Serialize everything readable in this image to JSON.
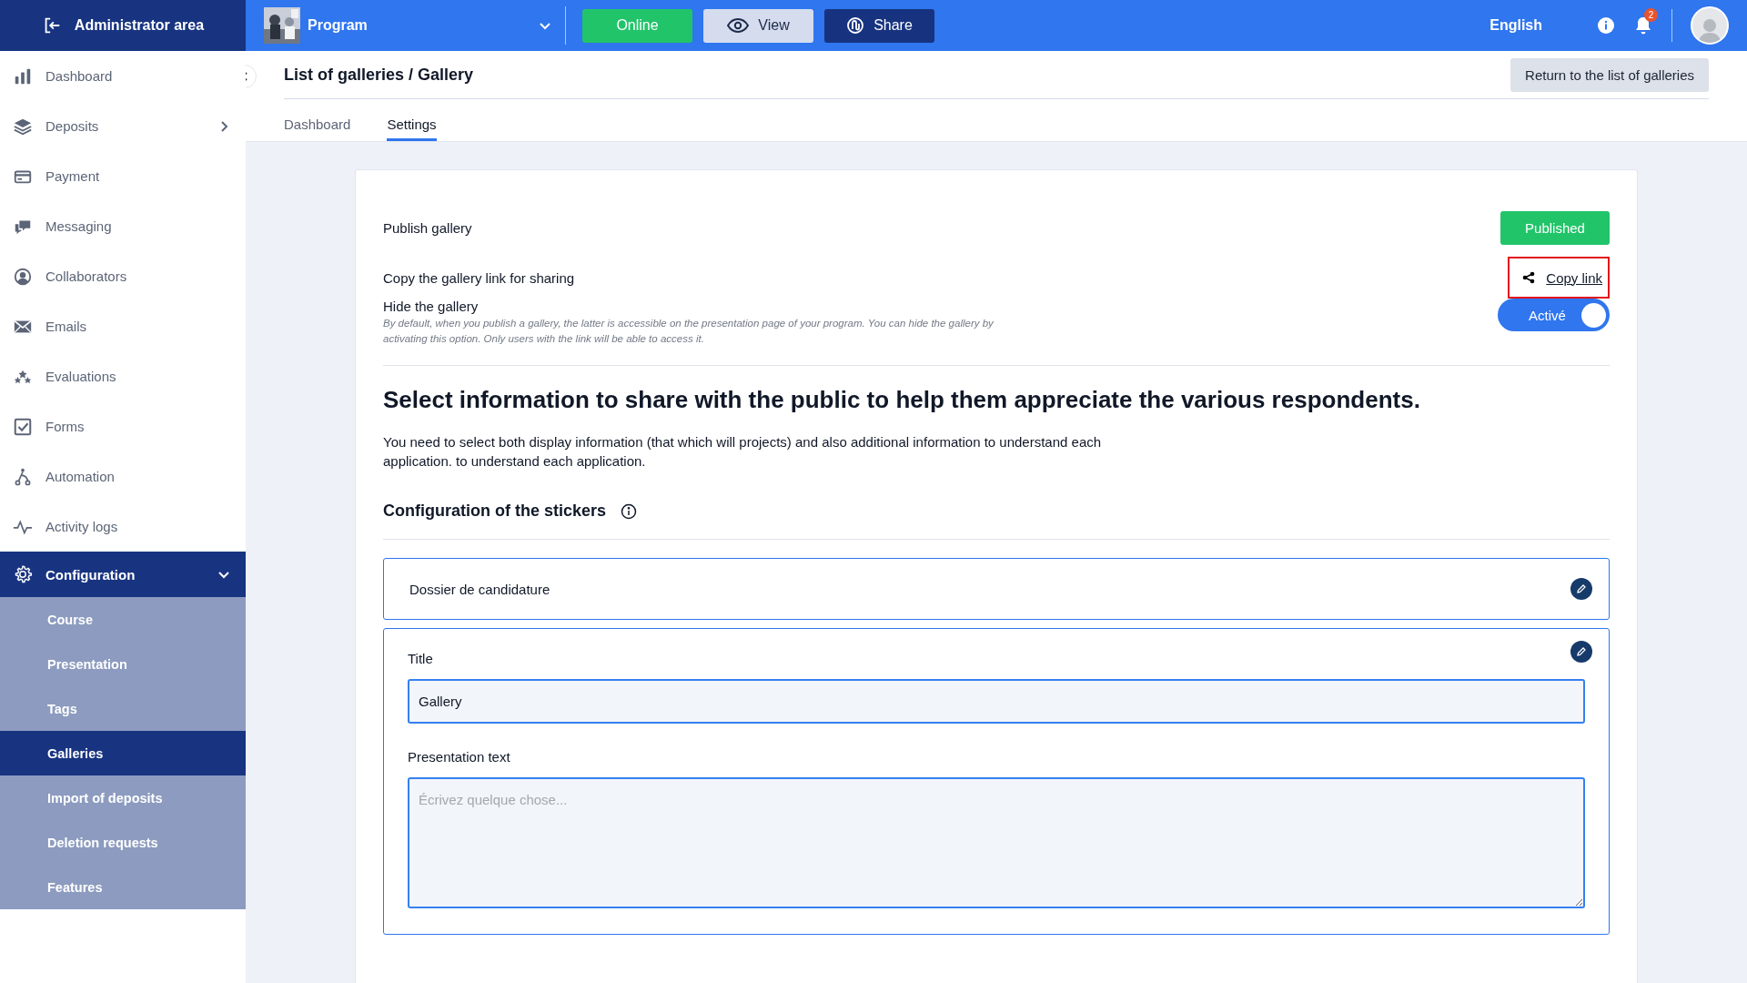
{
  "topbar": {
    "admin_label": "Administrator area",
    "program": {
      "name": "Program"
    },
    "status_button": "Online",
    "view_button": "View",
    "share_button": "Share",
    "language": "English",
    "notification_count": "2"
  },
  "sidebar": {
    "items": [
      {
        "label": "Dashboard",
        "kind": "link",
        "selected": false
      },
      {
        "label": "Deposits",
        "kind": "group",
        "expanded": false,
        "selected": false
      },
      {
        "label": "Payment",
        "kind": "link",
        "selected": false
      },
      {
        "label": "Messaging",
        "kind": "link",
        "selected": false
      },
      {
        "label": "Collaborators",
        "kind": "link",
        "selected": false
      },
      {
        "label": "Emails",
        "kind": "link",
        "selected": false
      },
      {
        "label": "Evaluations",
        "kind": "link",
        "selected": false
      },
      {
        "label": "Forms",
        "kind": "link",
        "selected": false
      },
      {
        "label": "Automation",
        "kind": "link",
        "selected": false
      },
      {
        "label": "Activity logs",
        "kind": "link",
        "selected": false
      },
      {
        "label": "Configuration",
        "kind": "group",
        "expanded": true,
        "selected": true,
        "children": [
          {
            "label": "Course",
            "selected": false
          },
          {
            "label": "Presentation",
            "selected": false
          },
          {
            "label": "Tags",
            "selected": false
          },
          {
            "label": "Galleries",
            "selected": true
          },
          {
            "label": "Import of deposits",
            "selected": false
          },
          {
            "label": "Deletion requests",
            "selected": false
          },
          {
            "label": "Features",
            "selected": false
          }
        ]
      }
    ]
  },
  "page": {
    "title": "List of galleries / Gallery",
    "return_button": "Return to the list of galleries",
    "tabs": [
      {
        "label": "Dashboard",
        "selected": false
      },
      {
        "label": "Settings",
        "selected": true
      }
    ]
  },
  "settings": {
    "publish": {
      "label": "Publish gallery",
      "button": "Published"
    },
    "copy": {
      "label": "Copy the gallery link for sharing",
      "link": "Copy link"
    },
    "hide": {
      "label": "Hide the gallery",
      "description": "By default, when you publish a gallery, the latter is accessible on the presentation page of your program. You can hide the gallery by activating this option. Only users with the link will be able to access it.",
      "toggle": {
        "label": "Activé",
        "on": true
      }
    },
    "heading": "Select information to share with the public to help them appreciate the various respondents.",
    "intro": "You need to select both display information (that which will projects) and also additional information to understand each application. to understand each application.",
    "stickers_heading": "Configuration of the stickers",
    "stickers": [
      {
        "title": "Dossier de candidature",
        "expanded": false
      },
      {
        "expanded": true,
        "fields": [
          {
            "label": "Title",
            "kind": "input",
            "value": "Gallery"
          },
          {
            "label": "Presentation text",
            "kind": "textarea",
            "placeholder": "Écrivez quelque chose..."
          }
        ]
      }
    ]
  }
}
